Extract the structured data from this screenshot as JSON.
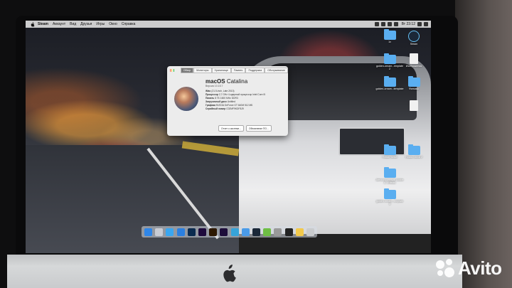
{
  "menubar": {
    "app_name": "Steam",
    "items": [
      "Аккаунт",
      "Вид",
      "Друзья",
      "Игры",
      "Окно",
      "Справка"
    ],
    "clock": "Вт 23:12"
  },
  "about_window": {
    "tabs": [
      "Обзор",
      "Мониторы",
      "Хранилище",
      "Память",
      "Поддержка",
      "Обслуживание"
    ],
    "os_name_bold": "macOS",
    "os_name_rest": "Catalina",
    "version": "Версия 10.15.7",
    "specs": [
      {
        "k": "iMac",
        "v": "(21.5-inch, Late 2013)"
      },
      {
        "k": "Процессор",
        "v": "2,7 GHz 4-ядерный процессор Intel Core i5"
      },
      {
        "k": "Память",
        "v": "8 ГБ 1600 MHz DDR3"
      },
      {
        "k": "Загрузочный диск",
        "v": "Untitled"
      },
      {
        "k": "Графика",
        "v": "NVIDIA GeForce GT 640M 512 МБ"
      },
      {
        "k": "Серийный номер",
        "v": "C02MF9KDF8J9"
      }
    ],
    "buttons": [
      "Отчет о системе...",
      "Обновление ПО..."
    ]
  },
  "desktop_icons": [
    {
      "label": "1x",
      "kind": "folder"
    },
    {
      "label": "Steam",
      "kind": "steam"
    },
    {
      "label": "golden-ornam...emplate 2",
      "kind": "folder"
    },
    {
      "label": "Изображения",
      "kind": "file"
    },
    {
      "label": "golden-ornam...template",
      "kind": "folder"
    },
    {
      "label": "Фильмы",
      "kind": "folder"
    },
    {
      "label": "",
      "kind": "file"
    },
    {
      "label": "Новая папка",
      "kind": "folder"
    },
    {
      "label": "Новая папка 2",
      "kind": "folder"
    },
    {
      "label": "Автосохранение Adobe A...Effects",
      "kind": "folder"
    },
    {
      "label": "golden-ornam...emplate 3",
      "kind": "folder"
    }
  ],
  "dock": [
    "Finder",
    "Launchpad",
    "Safari",
    "App Store",
    "Ps",
    "Ae",
    "Ai",
    "Pr",
    "Telegram",
    "Mail",
    "Steam",
    "Utorrent",
    "Keychain",
    "Terminal",
    "Notes",
    "Trash"
  ],
  "dock_colors": [
    "#2f86e8",
    "#c9ccd4",
    "#3aa6f0",
    "#2b7fe0",
    "#0b2b4f",
    "#1e0a3c",
    "#2c1700",
    "#1d0d3a",
    "#36a3d9",
    "#4a9be8",
    "#1b2838",
    "#6fbe44",
    "#999999",
    "#222222",
    "#f2c94c",
    "#c9cbcd"
  ],
  "watermark": "Avito"
}
